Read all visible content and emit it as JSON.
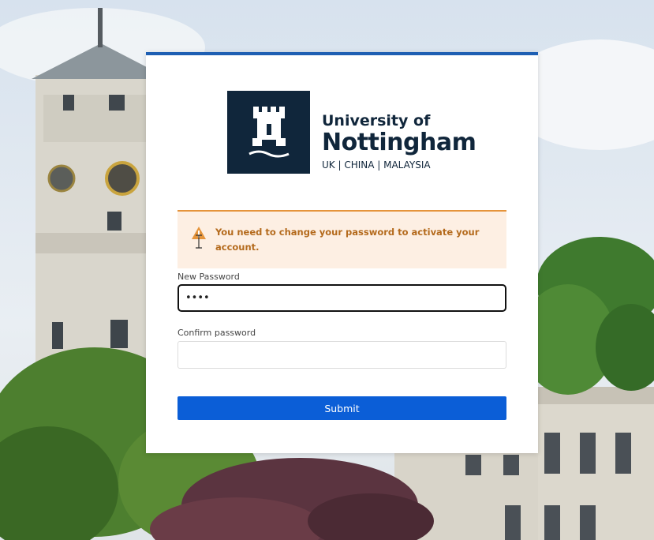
{
  "brand": {
    "line1": "University of",
    "line2": "Nottingham",
    "line3": "UK | CHINA | MALAYSIA",
    "logo_icon": "castle-tower-icon",
    "colors": {
      "navy": "#10263b",
      "accent": "#1e5fb3"
    }
  },
  "alert": {
    "icon": "warning-triangle-icon",
    "message": "You need to change your password to activate your account.",
    "colors": {
      "background": "#fdefe3",
      "border": "#e5943b",
      "text": "#b46a1c"
    }
  },
  "form": {
    "new_password_label": "New Password",
    "new_password_value": "••••",
    "confirm_password_label": "Confirm password",
    "confirm_password_value": "",
    "submit_label": "Submit",
    "submit_color": "#0b5ed7"
  }
}
